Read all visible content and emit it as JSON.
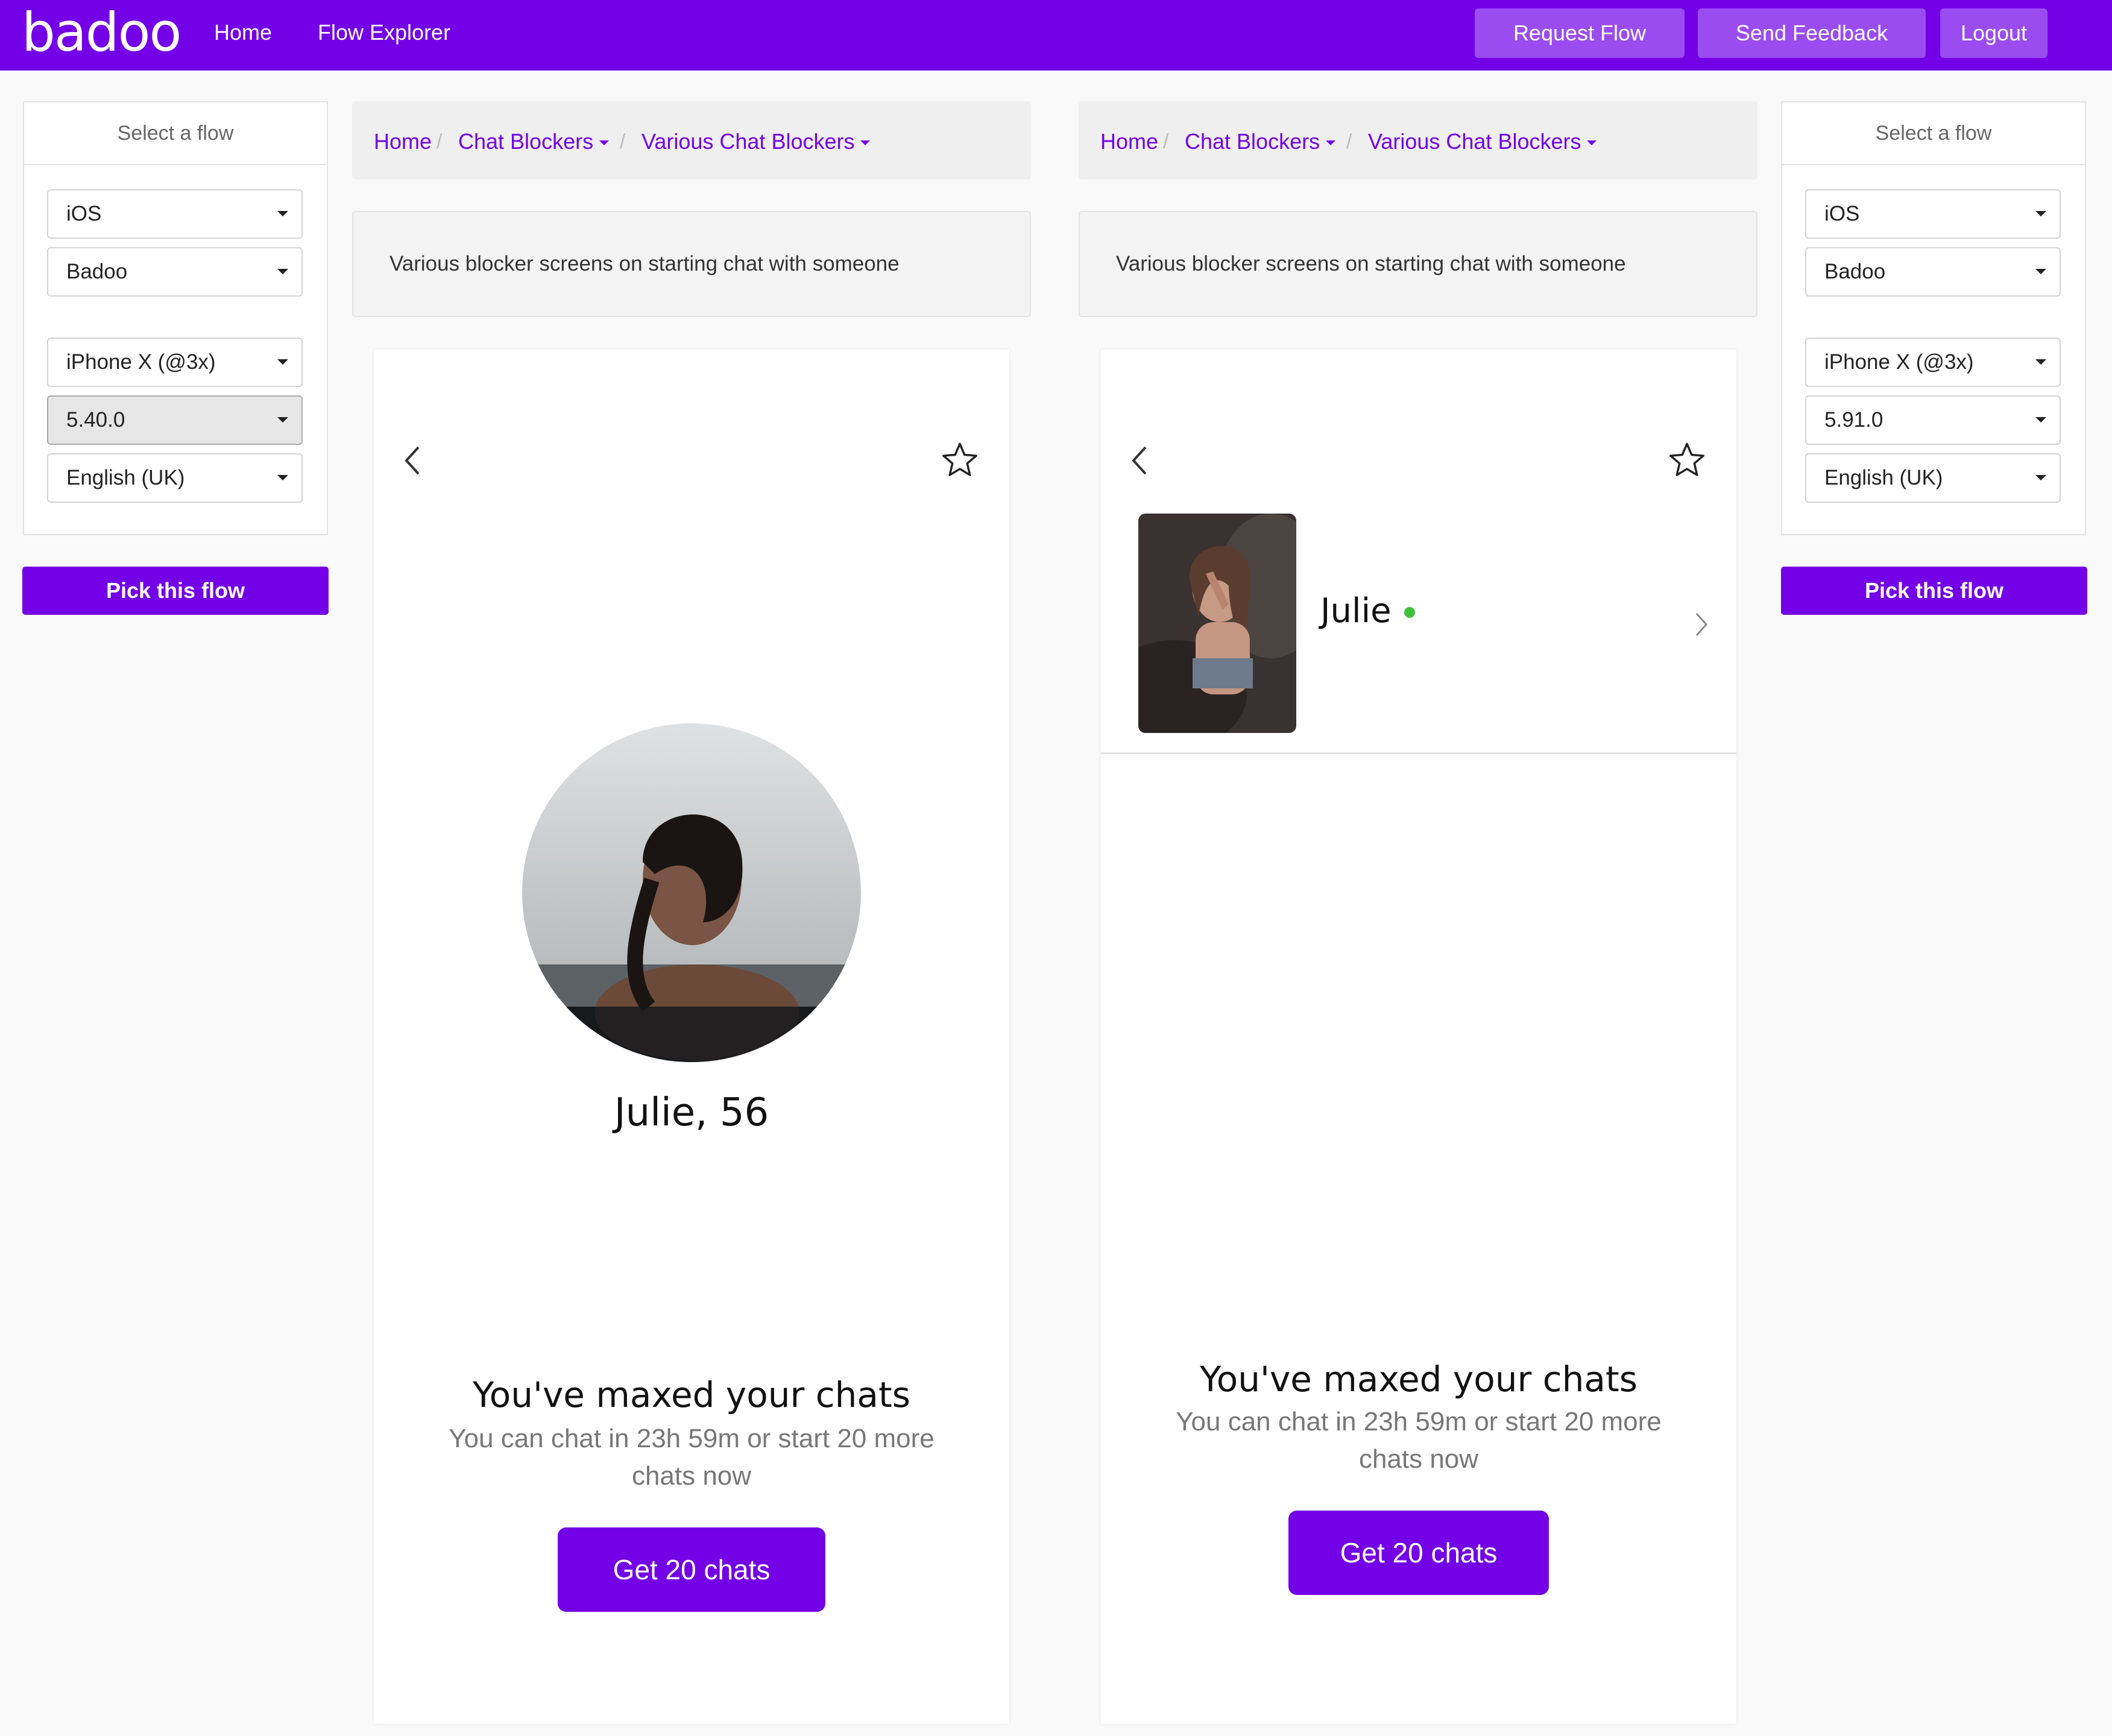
{
  "nav": {
    "logo": "badoo",
    "links": [
      "Home",
      "Flow Explorer"
    ],
    "buttons": [
      "Request Flow",
      "Send Feedback",
      "Logout"
    ]
  },
  "left_panel": {
    "title": "Select a flow",
    "platform": "iOS",
    "app": "Badoo",
    "device": "iPhone X (@3x)",
    "version": "5.40.0",
    "language": "English (UK)",
    "pick_label": "Pick this flow"
  },
  "right_panel": {
    "title": "Select a flow",
    "platform": "iOS",
    "app": "Badoo",
    "device": "iPhone X (@3x)",
    "version": "5.91.0",
    "language": "English (UK)",
    "pick_label": "Pick this flow"
  },
  "left_view": {
    "breadcrumb": [
      "Home",
      "Chat Blockers",
      "Various Chat Blockers"
    ],
    "description": "Various blocker screens on starting chat with someone",
    "screen": {
      "profile_name": "Julie, 56",
      "headline": "You've maxed your chats",
      "subtext": "You can chat in 23h 59m or start 20 more chats now",
      "cta": "Get 20 chats"
    }
  },
  "right_view": {
    "breadcrumb": [
      "Home",
      "Chat Blockers",
      "Various Chat Blockers"
    ],
    "description": "Various blocker screens on starting chat with someone",
    "screen": {
      "profile_name": "Julie",
      "online_color": "#3cc13b",
      "headline": "You've maxed your chats",
      "subtext": "You can chat in 23h 59m or start 20 more chats now",
      "cta": "Get 20 chats"
    }
  },
  "colors": {
    "brand": "#7300e6",
    "nav_button": "#9a4cf0"
  }
}
